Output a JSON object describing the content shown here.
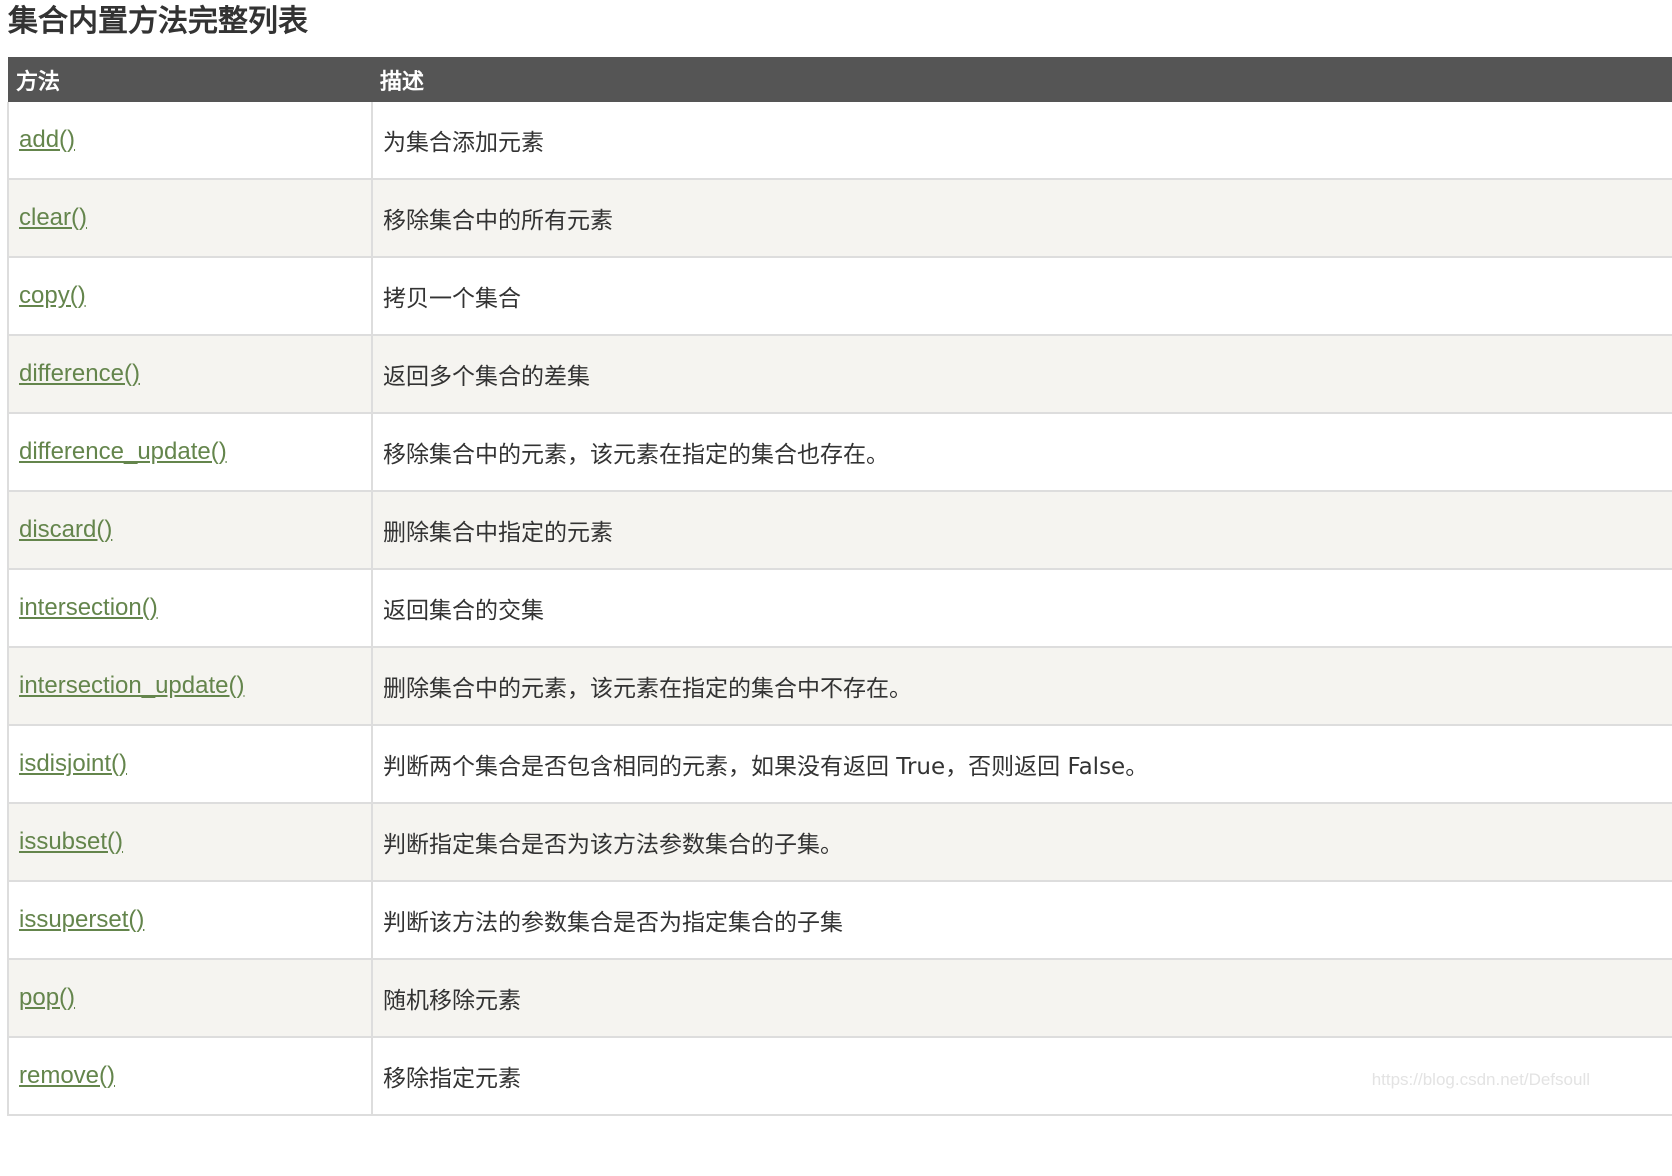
{
  "page": {
    "title": "集合内置方法完整列表"
  },
  "table": {
    "headers": {
      "method": "方法",
      "description": "描述"
    },
    "rows": [
      {
        "method": "add()",
        "description": "为集合添加元素"
      },
      {
        "method": "clear()",
        "description": "移除集合中的所有元素"
      },
      {
        "method": "copy()",
        "description": "拷贝一个集合"
      },
      {
        "method": "difference()",
        "description": "返回多个集合的差集"
      },
      {
        "method": "difference_update()",
        "description": "移除集合中的元素，该元素在指定的集合也存在。"
      },
      {
        "method": "discard()",
        "description": "删除集合中指定的元素"
      },
      {
        "method": "intersection()",
        "description": "返回集合的交集"
      },
      {
        "method": "intersection_update()",
        "description": "删除集合中的元素，该元素在指定的集合中不存在。"
      },
      {
        "method": "isdisjoint()",
        "description": "判断两个集合是否包含相同的元素，如果没有返回 True，否则返回 False。"
      },
      {
        "method": "issubset()",
        "description": "判断指定集合是否为该方法参数集合的子集。"
      },
      {
        "method": "issuperset()",
        "description": "判断该方法的参数集合是否为指定集合的子集"
      },
      {
        "method": "pop()",
        "description": "随机移除元素"
      },
      {
        "method": "remove()",
        "description": "移除指定元素"
      }
    ]
  },
  "watermark": "https://blog.csdn.net/Defsoull",
  "colors": {
    "header_bg": "#555555",
    "link": "#64854c",
    "alt_row_bg": "#f5f4f0",
    "border": "#dddddd"
  }
}
